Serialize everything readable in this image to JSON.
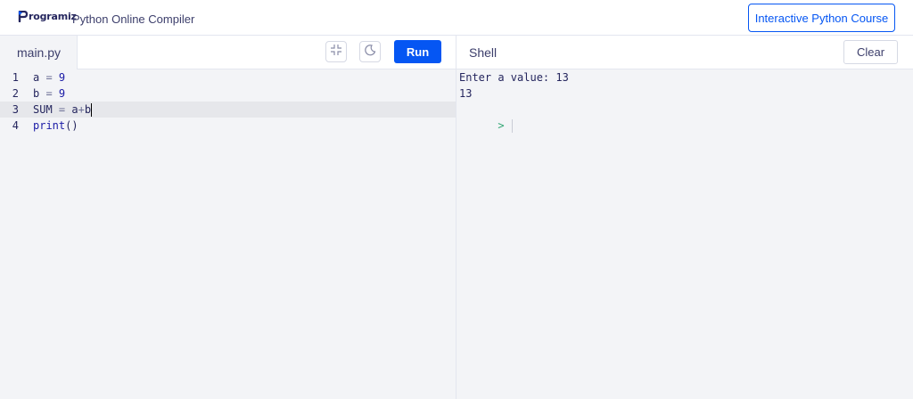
{
  "header": {
    "logo_text": "rogramiz",
    "title": "Python Online Compiler",
    "course_button": "Interactive Python Course"
  },
  "editor": {
    "file_tab": "main.py",
    "run_label": "Run",
    "icons": [
      "collapse-icon",
      "dark-mode-icon"
    ],
    "lines": [
      {
        "num": "1",
        "parts": [
          {
            "t": "a",
            "c": "id"
          },
          {
            "t": " = ",
            "c": "op"
          },
          {
            "t": "9",
            "c": "num"
          }
        ]
      },
      {
        "num": "2",
        "parts": [
          {
            "t": "b",
            "c": "id"
          },
          {
            "t": " = ",
            "c": "op"
          },
          {
            "t": "9",
            "c": "num"
          }
        ]
      },
      {
        "num": "3",
        "parts": [
          {
            "t": "SUM",
            "c": "id"
          },
          {
            "t": " = ",
            "c": "op"
          },
          {
            "t": "a",
            "c": "id"
          },
          {
            "t": "+",
            "c": "op"
          },
          {
            "t": "b",
            "c": "id"
          }
        ]
      },
      {
        "num": "4",
        "parts": [
          {
            "t": "print",
            "c": "fn"
          },
          {
            "t": "()",
            "c": "id"
          }
        ]
      }
    ],
    "active_line": 3
  },
  "shell": {
    "title": "Shell",
    "clear_label": "Clear",
    "output": [
      "Enter a value: 13",
      "13"
    ],
    "prompt": ">"
  },
  "colors": {
    "accent": "#0556f3",
    "text": "#25265e",
    "number": "#1a1aa6",
    "prompt": "#2fa572"
  }
}
